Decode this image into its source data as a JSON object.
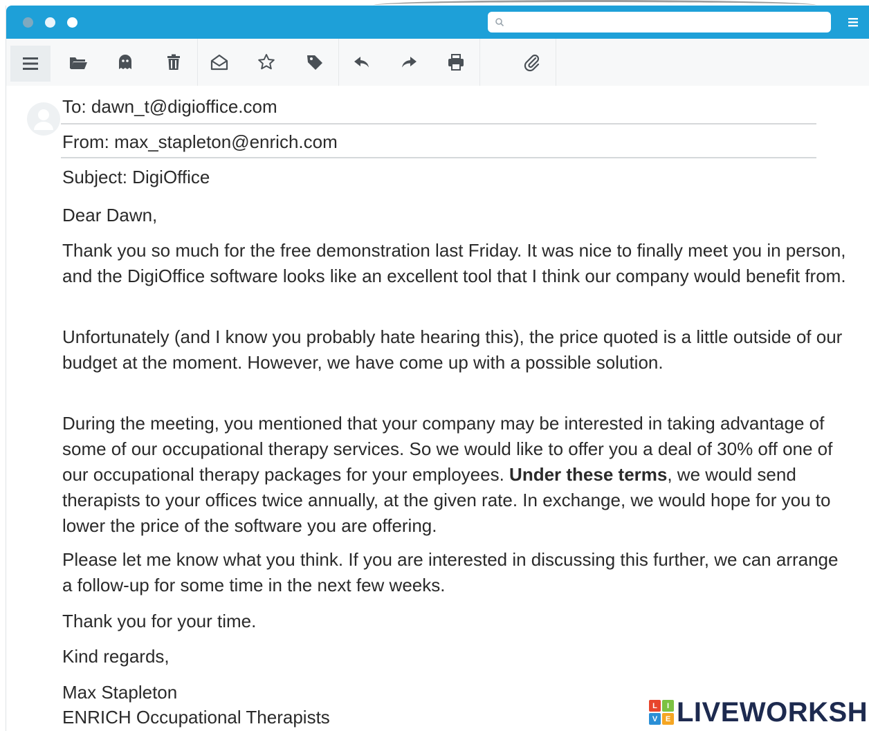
{
  "window": {
    "search": {
      "placeholder": "",
      "value": ""
    }
  },
  "toolbar": {
    "buttons": [
      {
        "name": "menu-button",
        "icon": "hamburger-icon"
      },
      {
        "name": "open-folder-button",
        "icon": "folder-open-icon"
      },
      {
        "name": "junk-button",
        "icon": "ghost-icon"
      },
      {
        "name": "delete-button",
        "icon": "trash-icon"
      },
      {
        "name": "mark-read-button",
        "icon": "envelope-open-icon"
      },
      {
        "name": "star-button",
        "icon": "star-icon"
      },
      {
        "name": "tag-button",
        "icon": "tag-icon"
      },
      {
        "name": "reply-button",
        "icon": "reply-icon"
      },
      {
        "name": "forward-button",
        "icon": "forward-icon"
      },
      {
        "name": "print-button",
        "icon": "print-icon"
      },
      {
        "name": "attach-button",
        "icon": "paperclip-icon"
      }
    ]
  },
  "email": {
    "to": "To: dawn_t@digioffice.com",
    "from": "From: max_stapleton@enrich.com",
    "subject": "Subject: DigiOffice",
    "greeting": "Dear Dawn,",
    "p1": "Thank you so much for the free demonstration last Friday. It was nice to finally meet you in person, and the DigiOffice software looks like an excellent tool that I think our company would benefit from.",
    "p2": "Unfortunately (and I know you probably hate hearing this), the price quoted is a little outside of our budget at the moment. However, we have come up with a possible solution.",
    "p3_a": "During the meeting, you mentioned that your company may be interested in taking advantage of some of our occupational therapy services. So we would like to offer you a deal of 30% off one of our occupational therapy packages for your employees. ",
    "p3_bold": "Under these terms",
    "p3_b": ", we would send therapists to your offices twice annually, at the given rate. In exchange, we would hope for you to lower the price of the software you are offering.",
    "p4": "Please let me know what you think. If you are interested in discussing this further, we can arrange a follow-up for some time in the next few weeks.",
    "thanks": "Thank you for your time.",
    "closing": "Kind regards,",
    "sig_name": "Max Stapleton",
    "sig_company": "ENRICH Occupational Therapists"
  },
  "watermark": {
    "logo_letters": [
      "L",
      "I",
      "V",
      "E"
    ],
    "logo_colors": [
      "#e8452c",
      "#7cc242",
      "#2b8fd6",
      "#f5a623"
    ],
    "text": "LIVEWORKSH"
  }
}
